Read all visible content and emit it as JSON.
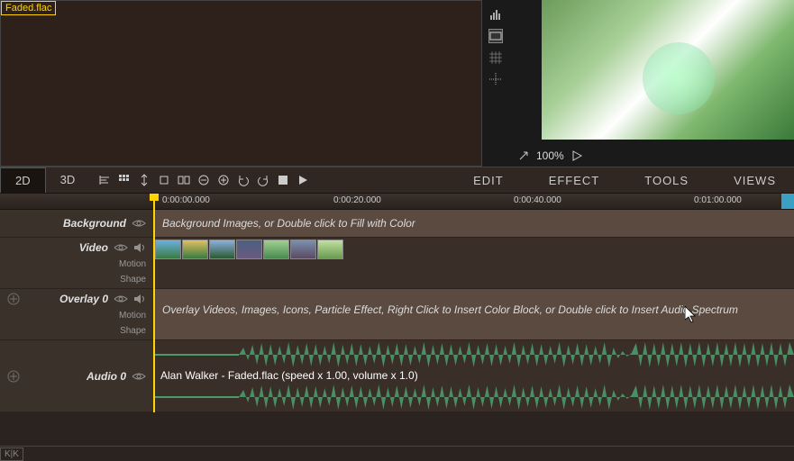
{
  "media": {
    "selected_file": "Faded.flac"
  },
  "preview": {
    "zoom": "100%"
  },
  "tabs": {
    "t2d": "2D",
    "t3d": "3D"
  },
  "menus": {
    "edit": "EDIT",
    "effect": "EFFECT",
    "tools": "TOOLS",
    "views": "VIEWS"
  },
  "ruler": {
    "t0": "0:00:00.000",
    "t1": "0:00:20.000",
    "t2": "0:00:40.000",
    "t3": "0:01:00.000"
  },
  "tracks": {
    "background": {
      "label": "Background",
      "placeholder": "Background Images, or Double click to Fill with Color"
    },
    "video": {
      "label": "Video",
      "sub1": "Motion",
      "sub2": "Shape"
    },
    "overlay0": {
      "label": "Overlay 0",
      "sub1": "Motion",
      "sub2": "Shape",
      "placeholder": "Overlay Videos, Images, Icons, Particle Effect, Right Click to Insert Color Block, or Double click to Insert Audio Spectrum"
    },
    "audio0": {
      "label": "Audio 0",
      "clip_label": "Alan Walker - Faded.flac  (speed x 1.00, volume x 1.0)"
    }
  }
}
